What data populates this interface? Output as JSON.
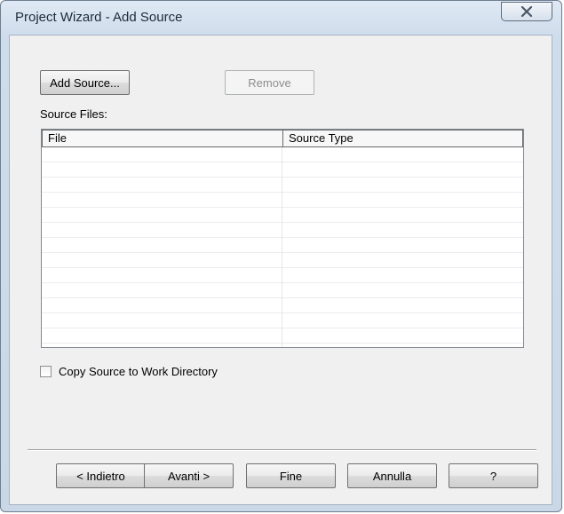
{
  "window": {
    "title": "Project Wizard - Add Source"
  },
  "toolbar": {
    "add_source_label": "Add Source...",
    "remove_label": "Remove"
  },
  "source_files": {
    "label": "Source Files:",
    "columns": [
      "File",
      "Source Type"
    ],
    "rows": []
  },
  "options": {
    "copy_source_label": "Copy Source to Work Directory",
    "copy_source_checked": false
  },
  "footer": {
    "back_label": "< Indietro",
    "next_label": "Avanti >",
    "finish_label": "Fine",
    "cancel_label": "Annulla",
    "help_label": "?"
  },
  "icons": {
    "close": "close-icon"
  },
  "colors": {
    "frame": "#cfdceb",
    "client": "#f0f0f0"
  }
}
